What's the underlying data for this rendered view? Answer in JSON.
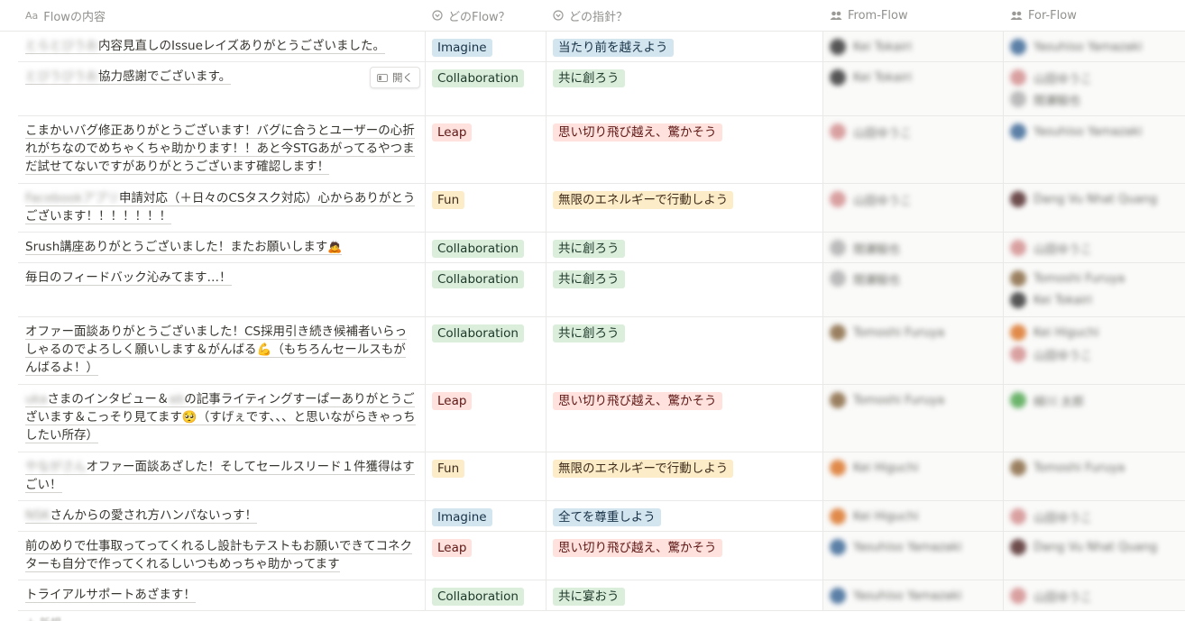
{
  "header": {
    "title_col": "Flowの内容",
    "title_icon": "Aa",
    "flow_col": "どのFlow？",
    "shishin_col": "どの指針？",
    "from_col": "From-Flow",
    "for_col": "For-Flow"
  },
  "open_button": "開く",
  "colors": {
    "blue": "#d3e5ef",
    "green": "#dbeddb",
    "red": "#ffe2dd",
    "orange": "#fadec9",
    "yellow": "#fdecc8"
  },
  "rows": [
    {
      "blur": "とらとびうお",
      "text": "内容見直しのIssueレイズありがとうございました。",
      "flow": "Imagine",
      "flow_color": "blue",
      "shishin": "当たり前を越えよう",
      "shishin_color": "blue",
      "from": [
        {
          "name": "Kei Tokairi",
          "color": "#555"
        }
      ],
      "for": [
        {
          "name": "Yasuhiso Yamazaki",
          "color": "#5b7fa6"
        }
      ]
    },
    {
      "blur": "とびうびうお",
      "text": "協力感謝でございます。",
      "flow": "Collaboration",
      "flow_color": "green",
      "shishin": "共に創ろう",
      "shishin_color": "green",
      "from": [
        {
          "name": "Kei Tokairi",
          "color": "#555"
        }
      ],
      "for": [
        {
          "name": "山田ゆうこ",
          "color": "#d9a0a0"
        },
        {
          "name": "間瀬駿也",
          "color": "#bbb"
        }
      ]
    },
    {
      "blur": "",
      "text": "こまかいバグ修正ありがとうございます！バグに合うとユーザーの心折れがちなのでめちゃくちゃ助かります！！あと今STGあがってるやつまだ試せてないですがありがとうございます確認します！",
      "flow": "Leap",
      "flow_color": "red",
      "shishin": "思い切り飛び越え、驚かそう",
      "shishin_color": "red",
      "from": [
        {
          "name": "山田ゆうこ",
          "color": "#d9a0a0"
        }
      ],
      "for": [
        {
          "name": "Yasuhiso Yamazaki",
          "color": "#5b7fa6"
        }
      ]
    },
    {
      "blur": "Facebookアプリ",
      "text": "申請対応（＋日々のCSタスク対応）心からありがとうございます！！！！！！！",
      "flow": "Fun",
      "flow_color": "yellow",
      "shishin": "無限のエネルギーで行動しよう",
      "shishin_color": "yellow",
      "from": [
        {
          "name": "山田ゆうこ",
          "color": "#d9a0a0"
        }
      ],
      "for": [
        {
          "name": "Dang Vu Nhat Quang",
          "color": "#6d4c4c"
        }
      ]
    },
    {
      "blur": "",
      "text": "Srush講座ありがとうございました！またお願いします",
      "emoji": "🙇",
      "flow": "Collaboration",
      "flow_color": "green",
      "shishin": "共に創ろう",
      "shishin_color": "green",
      "from": [
        {
          "name": "間瀬駿也",
          "color": "#bbb"
        }
      ],
      "for": [
        {
          "name": "山田ゆうこ",
          "color": "#d9a0a0"
        }
      ]
    },
    {
      "blur": "",
      "text": "毎日のフィードバック沁みてます…！",
      "flow": "Collaboration",
      "flow_color": "green",
      "shishin": "共に創ろう",
      "shishin_color": "green",
      "from": [
        {
          "name": "間瀬駿也",
          "color": "#bbb"
        }
      ],
      "for": [
        {
          "name": "Tomoshi Furuya",
          "color": "#9a8060"
        },
        {
          "name": "Kei Tokairi",
          "color": "#555"
        }
      ]
    },
    {
      "blur": "",
      "text": "オファー面談ありがとうございました！CS採用引き続き候補者いらっしゃるのでよろしく願いします＆がんばる💪（もちろんセールスもがんばるよ！）",
      "flow": "Collaboration",
      "flow_color": "green",
      "shishin": "共に創ろう",
      "shishin_color": "green",
      "from": [
        {
          "name": "Tomoshi Furuya",
          "color": "#9a8060"
        }
      ],
      "for": [
        {
          "name": "Kei Higuchi",
          "color": "#e08a4a"
        },
        {
          "name": "山田ゆうこ",
          "color": "#d9a0a0"
        }
      ]
    },
    {
      "blur": "ukaさまのインタビュー＆abcの",
      "text": "さまのインタビュー＆",
      "text2": "の記事ライティングすーぱーありがとうございます＆こっそり見てます🥺（すげぇです、、、と思いながらきゃっちしたい所存）",
      "blur1": "uka",
      "blur2": "ab",
      "flow": "Leap",
      "flow_color": "red",
      "shishin": "思い切り飛び越え、驚かそう",
      "shishin_color": "red",
      "from": [
        {
          "name": "Tomoshi Furuya",
          "color": "#9a8060"
        }
      ],
      "for": [
        {
          "name": "緑川 太郎",
          "color": "#6cb46c"
        }
      ]
    },
    {
      "blur": "やながさん",
      "text": "オファー面談あざした！そしてセールスリード１件獲得はすごい！",
      "flow": "Fun",
      "flow_color": "yellow",
      "shishin": "無限のエネルギーで行動しよう",
      "shishin_color": "yellow",
      "from": [
        {
          "name": "Kei Higuchi",
          "color": "#e08a4a"
        }
      ],
      "for": [
        {
          "name": "Tomoshi Furuya",
          "color": "#9a8060"
        }
      ]
    },
    {
      "blur": "NSK",
      "text": "さんからの愛され方ハンパないっす！",
      "flow": "Imagine",
      "flow_color": "blue",
      "shishin": "全てを尊重しよう",
      "shishin_color": "blue",
      "from": [
        {
          "name": "Kei Higuchi",
          "color": "#e08a4a"
        }
      ],
      "for": [
        {
          "name": "山田ゆうこ",
          "color": "#d9a0a0"
        }
      ]
    },
    {
      "blur": "",
      "text": "前のめりで仕事取ってってくれるし設計もテストもお願いできてコネクターも自分で作ってくれるしいつもめっちゃ助かってます",
      "flow": "Leap",
      "flow_color": "red",
      "shishin": "思い切り飛び越え、驚かそう",
      "shishin_color": "red",
      "from": [
        {
          "name": "Yasuhiso Yamazaki",
          "color": "#5b7fa6"
        }
      ],
      "for": [
        {
          "name": "Dang Vu Nhat Quang",
          "color": "#6d4c4c"
        }
      ]
    },
    {
      "blur": "",
      "text": "トライアルサポートあざます！",
      "flow": "Collaboration",
      "flow_color": "green",
      "shishin": "共に宴おう",
      "shishin_color": "green",
      "from": [
        {
          "name": "Yasuhiso Yamazaki",
          "color": "#5b7fa6"
        }
      ],
      "for": [
        {
          "name": "山田ゆうこ",
          "color": "#d9a0a0"
        }
      ]
    }
  ],
  "new_row": "新規"
}
